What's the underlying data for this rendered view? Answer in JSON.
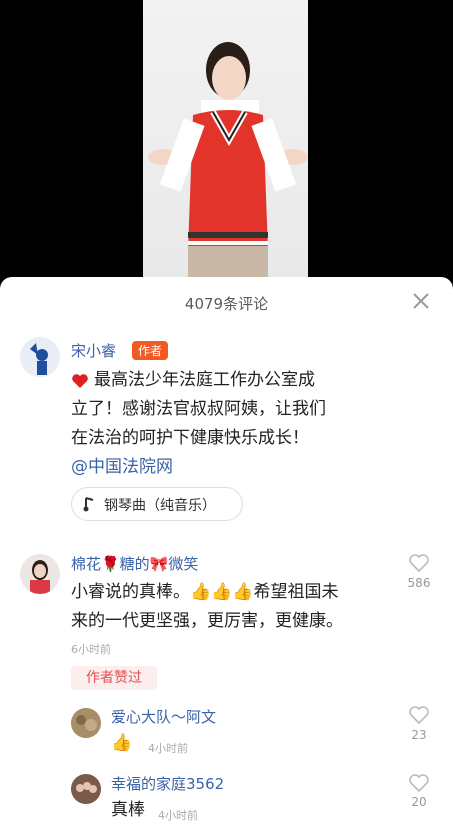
{
  "comments_header": {
    "title": "4079条评论"
  },
  "post": {
    "author": "宋小睿",
    "author_badge": "作者",
    "text_line1": "最高法少年法庭工作办公室成",
    "text_line2": "立了！感谢法官叔叔阿姨，让我们",
    "text_line3": "在法治的呵护下健康快乐成长！",
    "mention": "@中国法院网",
    "music": "钢琴曲（纯音乐）"
  },
  "comments": [
    {
      "author": "棉花🌹糖的🎀微笑",
      "text_line1": "小睿说的真棒。👍👍👍希望祖国未",
      "text_line2": "来的一代更坚强，更厉害，更健康。",
      "time": "6小时前",
      "likes": "586",
      "author_liked": "作者赞过"
    }
  ],
  "replies": [
    {
      "author": "爱心大队～阿文",
      "text": "👍",
      "time": "4小时前",
      "likes": "23"
    },
    {
      "author": "幸福的家庭3562",
      "text": "真棒",
      "time": "4小时前",
      "likes": "20"
    }
  ],
  "colors": {
    "accent": "#f15a22",
    "link": "#3a62a8",
    "name": "#3a62a8"
  },
  "icons": [
    "close-icon",
    "heart-icon",
    "music-note-icon",
    "like-icon"
  ]
}
